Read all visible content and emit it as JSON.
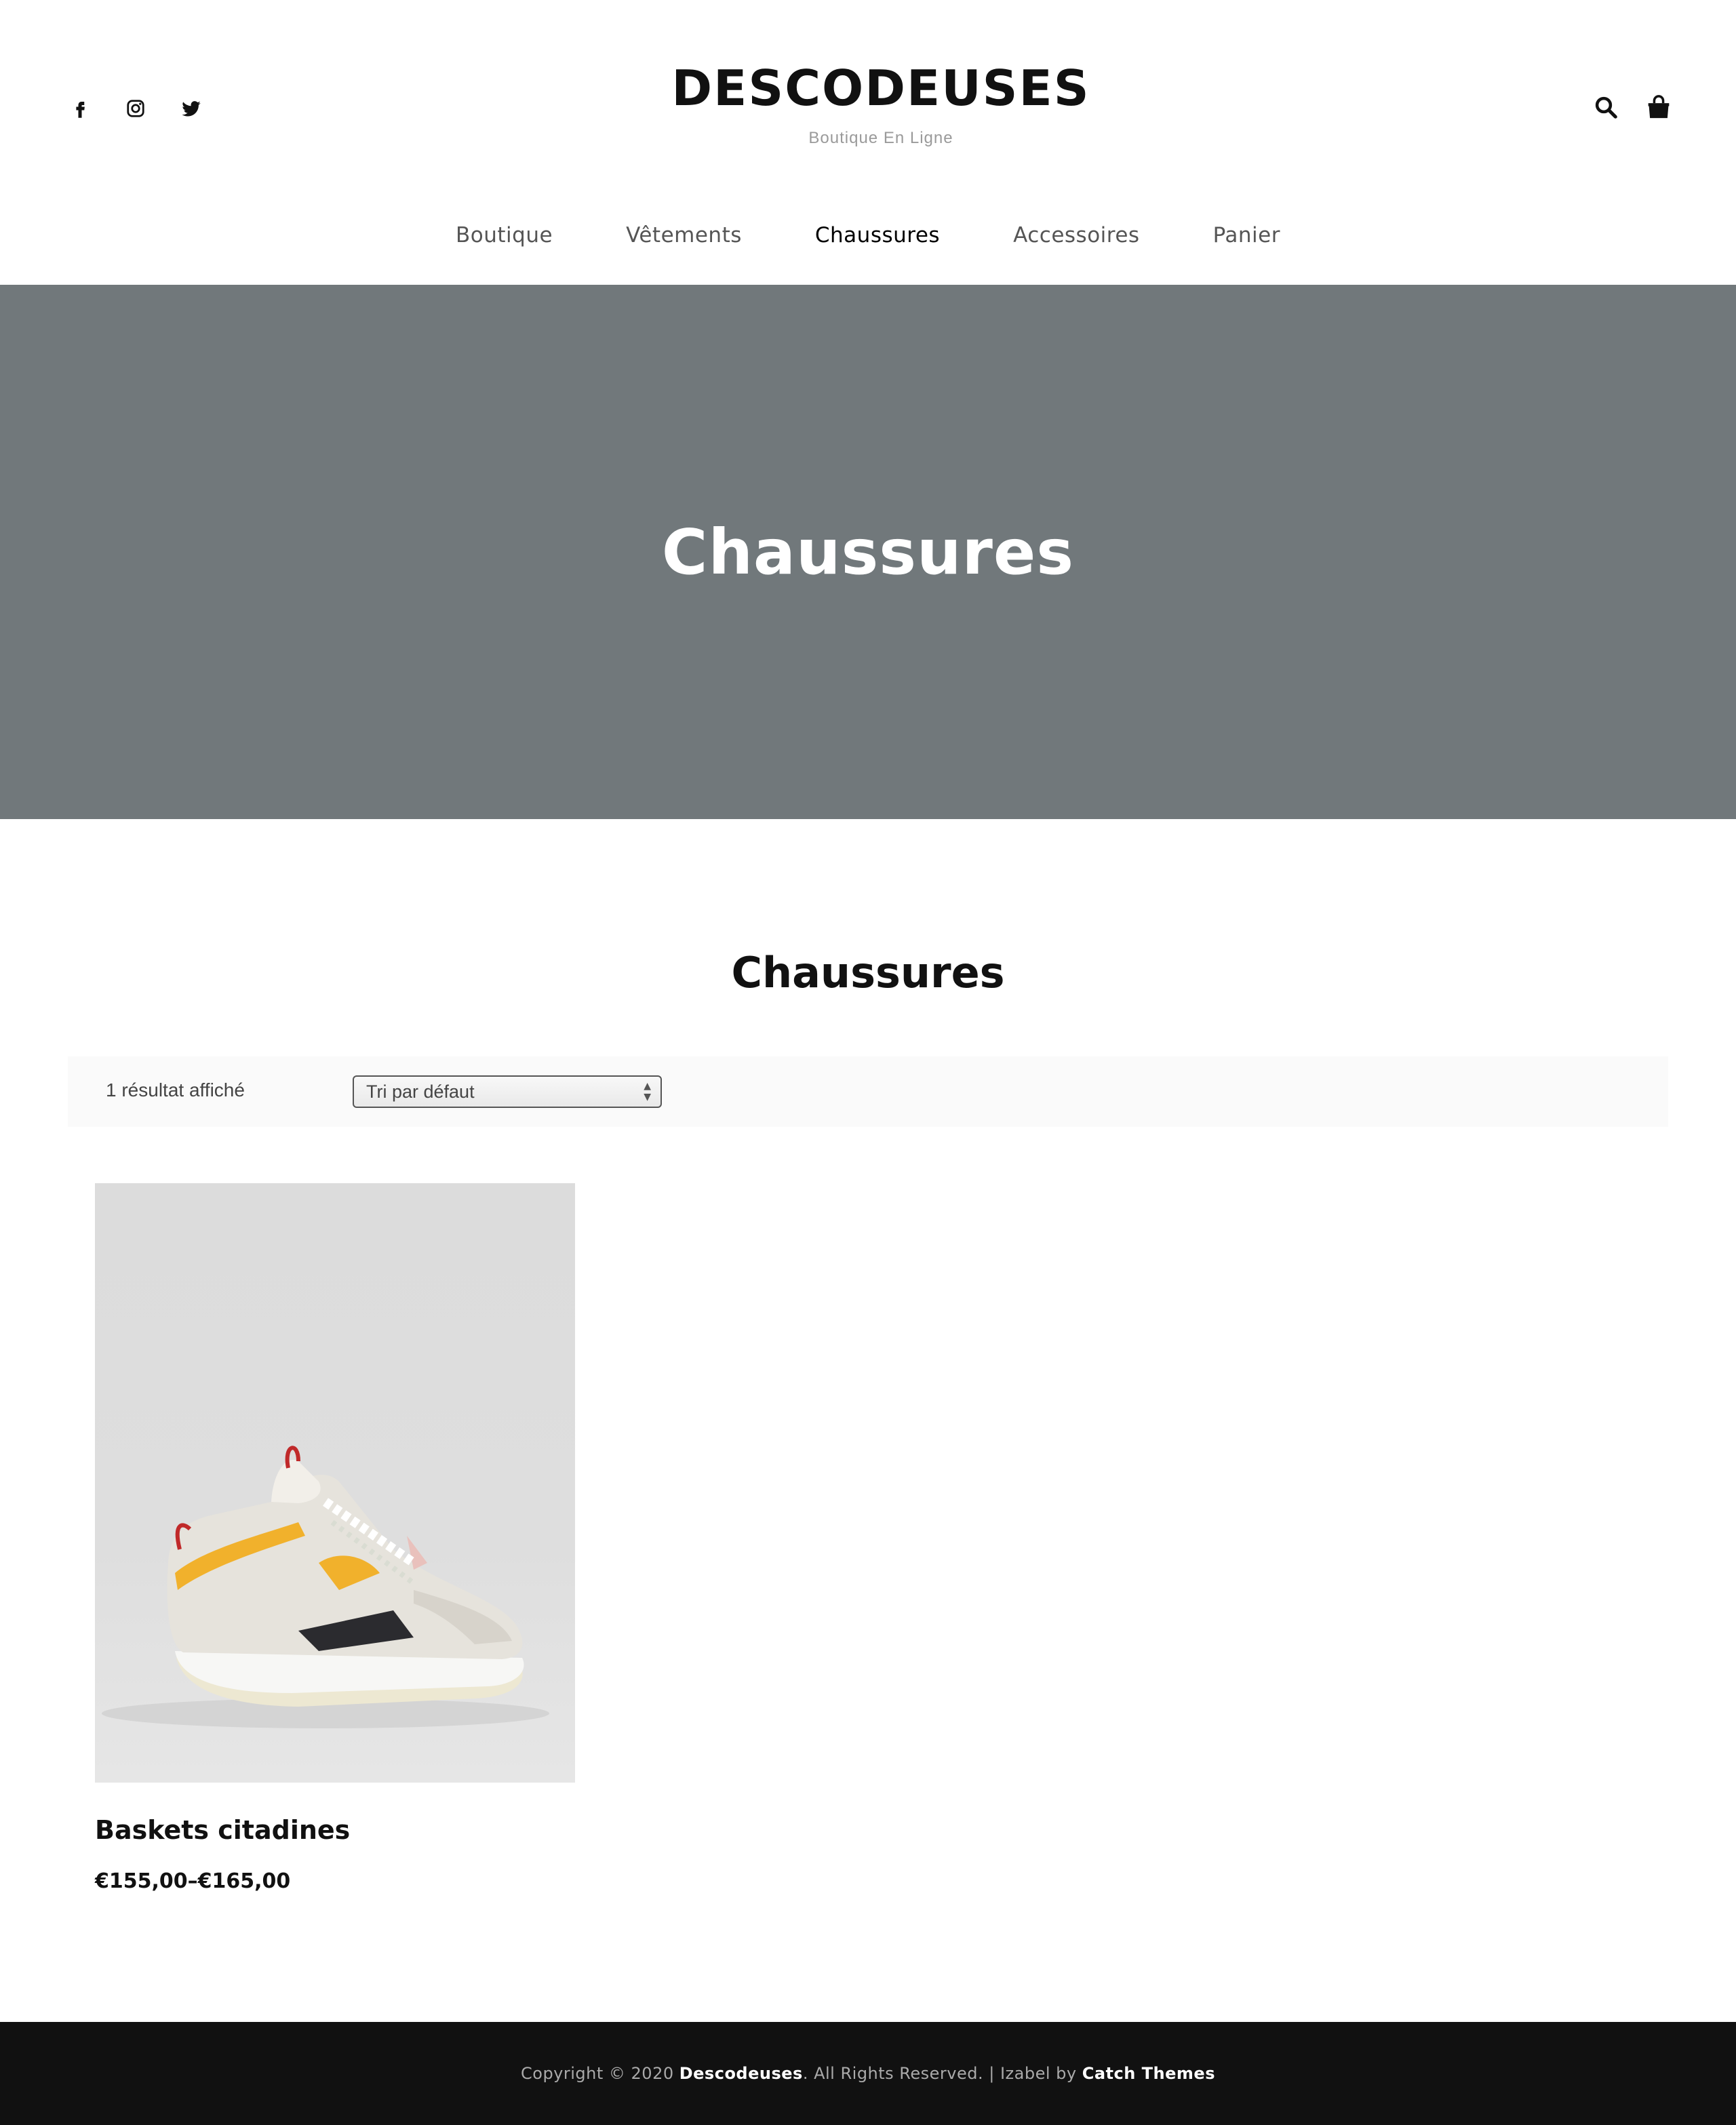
{
  "header": {
    "social": [
      {
        "icon": "facebook-icon"
      },
      {
        "icon": "instagram-icon"
      },
      {
        "icon": "twitter-icon"
      }
    ],
    "site_title": "DESCODEUSES",
    "tagline": "Boutique En Ligne",
    "tools": [
      {
        "icon": "search-icon"
      },
      {
        "icon": "shopping-bag-icon"
      }
    ]
  },
  "nav": {
    "items": [
      {
        "label": "Boutique"
      },
      {
        "label": "Vêtements"
      },
      {
        "label": "Chaussures",
        "active": true
      },
      {
        "label": "Accessoires"
      },
      {
        "label": "Panier"
      }
    ]
  },
  "hero": {
    "title": "Chaussures",
    "background_color": "#71787b"
  },
  "main": {
    "page_title": "Chaussures",
    "result_count": "1 résultat affiché",
    "orderby": {
      "selected": "Tri par défaut"
    },
    "products": [
      {
        "title": "Baskets citadines",
        "price": "€155,00–€165,00",
        "image": "sneaker-image"
      }
    ]
  },
  "footer": {
    "prefix": "Copyright © 2020 ",
    "site_link": "Descodeuses",
    "middle": ". All Rights Reserved. | Izabel by ",
    "theme_link": "Catch Themes",
    "background_color": "#111111"
  }
}
